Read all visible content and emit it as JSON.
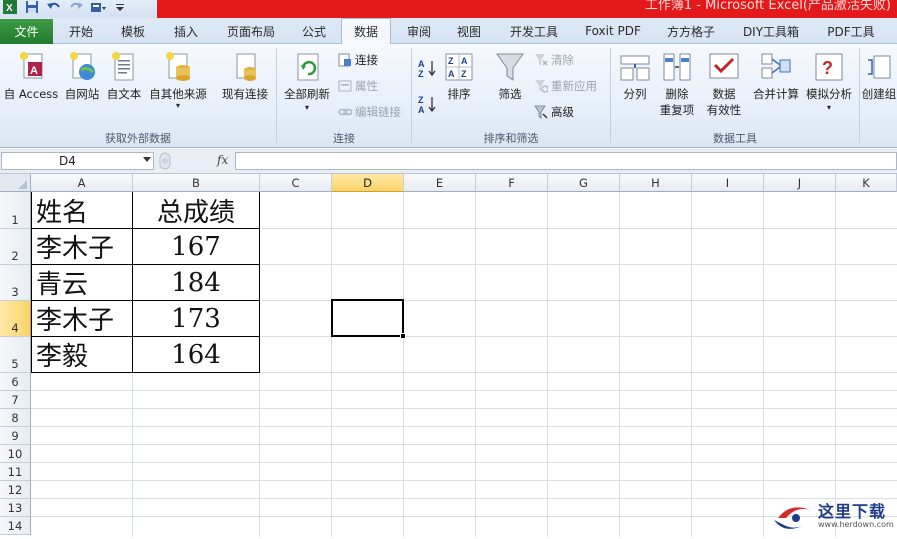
{
  "window": {
    "title": "工作簿1 - Microsoft Excel(产品激活失败)"
  },
  "quick_access": {
    "icons": [
      "excel-icon",
      "save-icon",
      "undo-icon",
      "redo-icon",
      "form-icon",
      "customize-icon"
    ]
  },
  "tabs": {
    "file": "文件",
    "items": [
      "开始",
      "模板",
      "插入",
      "页面布局",
      "公式",
      "数据",
      "审阅",
      "视图",
      "开发工具",
      "Foxit PDF",
      "方方格子",
      "DIY工具箱",
      "PDF工具"
    ],
    "active": "数据"
  },
  "ribbon": {
    "external_data": {
      "label": "获取外部数据",
      "buttons": [
        "自 Access",
        "自网站",
        "自文本",
        "自其他来源",
        "现有连接"
      ]
    },
    "connections": {
      "label": "连接",
      "refresh_all": "全部刷新",
      "connections": "连接",
      "properties": "属性",
      "edit_links": "编辑链接"
    },
    "sort_filter": {
      "label": "排序和筛选",
      "sort": "排序",
      "filter": "筛选",
      "clear": "清除",
      "reapply": "重新应用",
      "advanced": "高级"
    },
    "data_tools": {
      "label": "数据工具",
      "text_to_columns": "分列",
      "remove_duplicates_1": "删除",
      "remove_duplicates_2": "重复项",
      "validation_1": "数据",
      "validation_2": "有效性",
      "consolidate": "合并计算",
      "what_if": "模拟分析",
      "create_group": "创建组"
    }
  },
  "formula_bar": {
    "name_box": "D4",
    "fx": "fx",
    "value": ""
  },
  "sheet": {
    "columns": [
      "A",
      "B",
      "C",
      "D",
      "E",
      "F",
      "G",
      "H",
      "I",
      "J",
      "K"
    ],
    "rows": [
      "1",
      "2",
      "3",
      "4",
      "5",
      "6",
      "7",
      "8",
      "9",
      "10",
      "11",
      "12",
      "13",
      "14"
    ],
    "selected_cell": "D4",
    "table": {
      "headers": [
        "姓名",
        "总成绩"
      ],
      "records": [
        [
          "李木子",
          "167"
        ],
        [
          "青云",
          "184"
        ],
        [
          "李木子",
          "173"
        ],
        [
          "李毅",
          "164"
        ]
      ]
    }
  },
  "watermark": {
    "text": "这里下载",
    "url": "www.herdown.com"
  },
  "colors": {
    "title_red": "#e41a1a",
    "file_tab_green": "#2b8a36",
    "selected_header": "#f9d468"
  }
}
